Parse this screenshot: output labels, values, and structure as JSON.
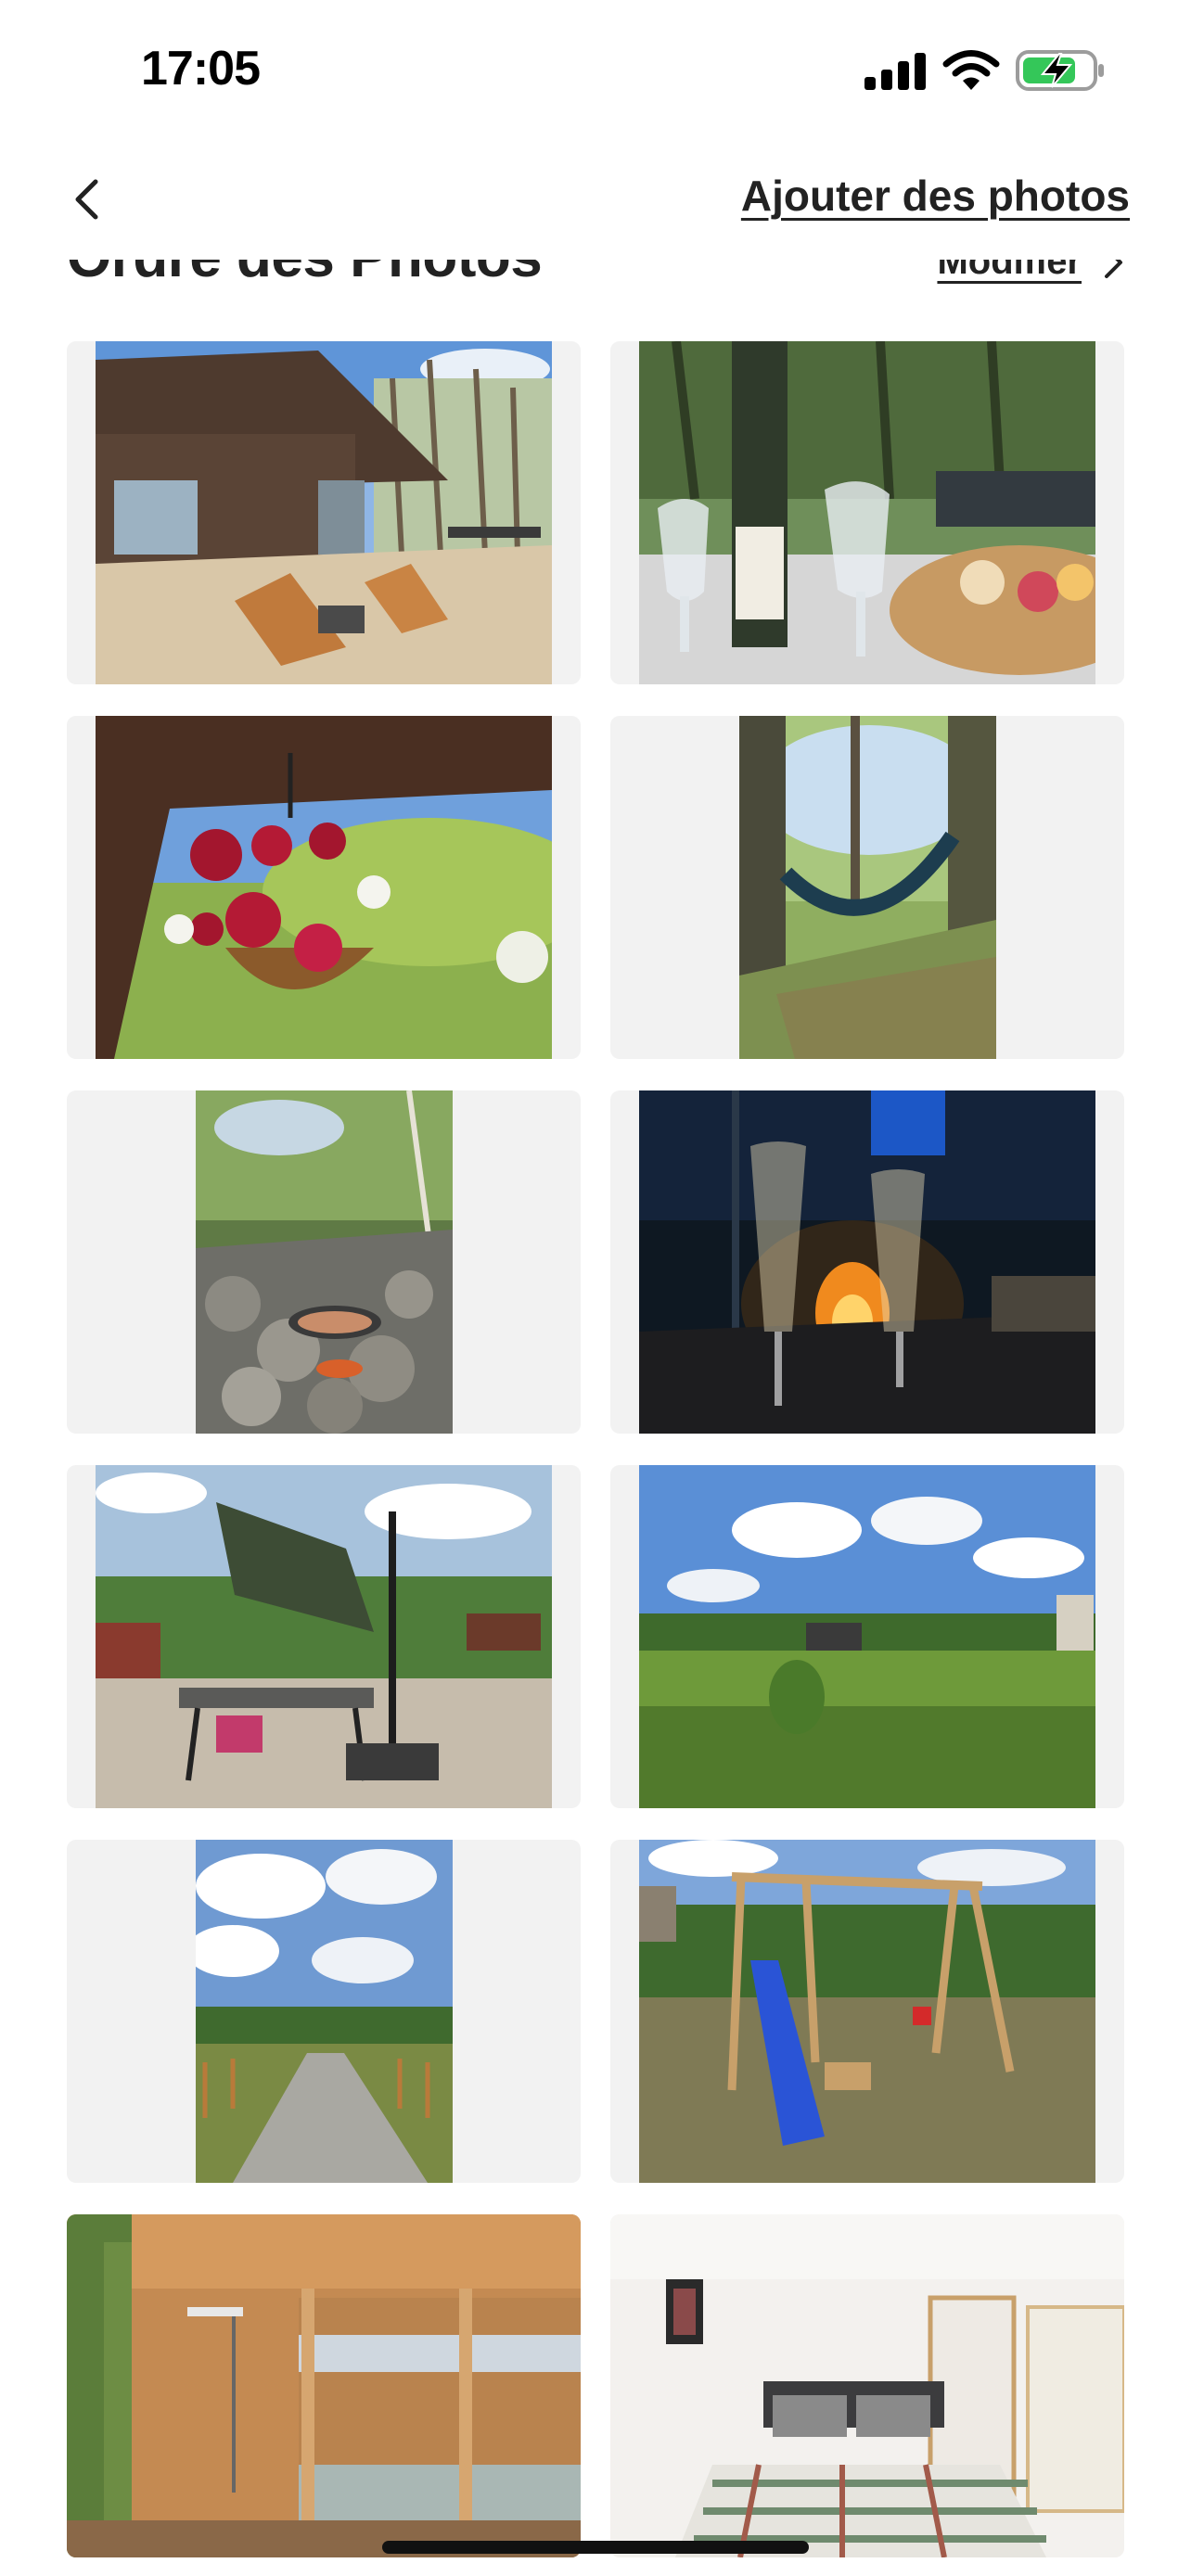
{
  "status_bar": {
    "time": "17:05",
    "icons": [
      "cellular-signal-icon",
      "wifi-icon",
      "battery-charging-icon"
    ],
    "battery_color": "#34c759"
  },
  "nav": {
    "back_icon": "chevron-left-icon",
    "add_photos_label": "Ajouter des photos"
  },
  "section": {
    "title": "Ordre des Photos",
    "edit_label": "Modifier",
    "edit_icon": "chevron-right-icon"
  },
  "photos": [
    {
      "subject": "chalet-terrace",
      "orientation": "landscape"
    },
    {
      "subject": "wine-and-charcuterie",
      "orientation": "landscape"
    },
    {
      "subject": "hanging-flower-basket",
      "orientation": "landscape"
    },
    {
      "subject": "hammock-in-woods",
      "orientation": "portrait"
    },
    {
      "subject": "fire-pit-grill",
      "orientation": "portrait"
    },
    {
      "subject": "champagne-by-fire",
      "orientation": "landscape"
    },
    {
      "subject": "patio-umbrella-table",
      "orientation": "landscape"
    },
    {
      "subject": "meadow-view",
      "orientation": "landscape"
    },
    {
      "subject": "gravel-path",
      "orientation": "portrait"
    },
    {
      "subject": "playground-swing-slide",
      "orientation": "landscape"
    },
    {
      "subject": "wooden-bunk-room",
      "orientation": "full"
    },
    {
      "subject": "bedroom-plaid-bed",
      "orientation": "full"
    }
  ],
  "colors": {
    "text": "#222222",
    "cell_background": "#f2f2f2",
    "background": "#ffffff"
  }
}
